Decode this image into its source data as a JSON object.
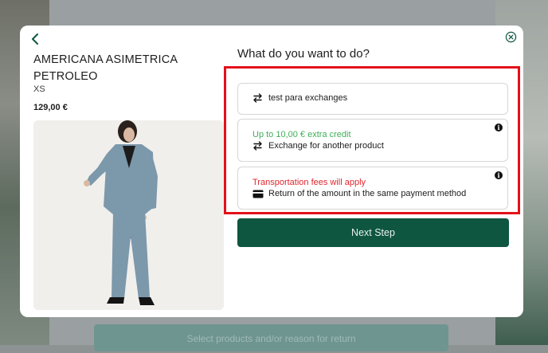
{
  "background": {
    "select_button_label": "Select products and/or reason for return"
  },
  "modal": {
    "back_icon": "chevron-left-icon",
    "close_icon": "close-circle-icon",
    "product": {
      "title": "AMERICANA ASIMETRICA PETROLEO",
      "size": "XS",
      "price": "129,00 €"
    },
    "question": "What do you want to do?",
    "options": [
      {
        "label": "test para exchanges",
        "icon": "swap-arrows-icon"
      },
      {
        "note": "Up to 10,00 € extra credit",
        "label": "Exchange for another product",
        "icon": "swap-arrows-icon",
        "info_icon": "info-icon"
      },
      {
        "note": "Transportation fees will apply",
        "label": "Return of the amount in the same payment method",
        "icon": "credit-card-icon",
        "info_icon": "info-icon"
      }
    ],
    "next_label": "Next Step"
  },
  "colors": {
    "accent": "#0f5640",
    "credit_note": "#3fae5a",
    "fee_note": "#e0262e",
    "highlight_border": "#e3101a"
  }
}
